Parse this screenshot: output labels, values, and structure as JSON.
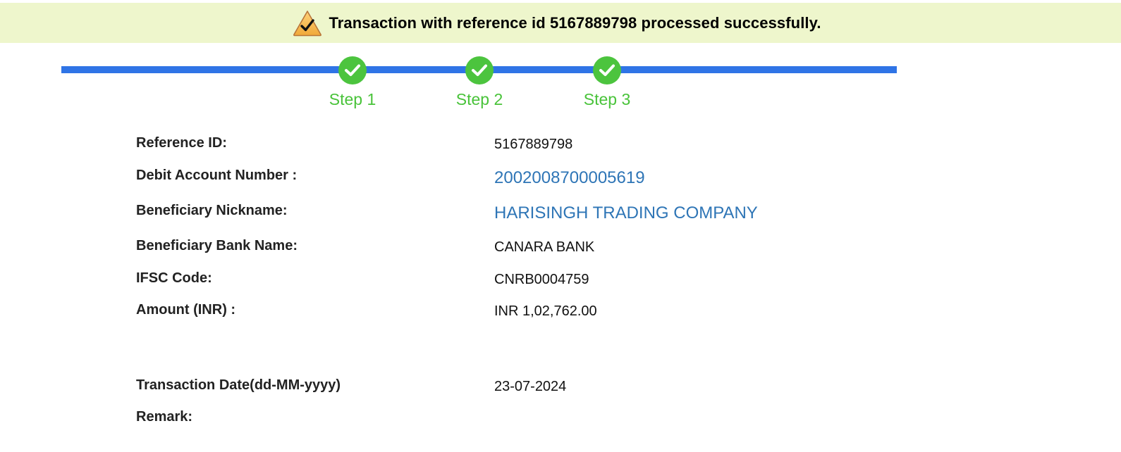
{
  "banner": {
    "message": "Transaction with reference id 5167889798 processed successfully.",
    "icon": "warning-check-icon"
  },
  "progress": {
    "steps": [
      {
        "label": "Step 1",
        "status": "complete"
      },
      {
        "label": "Step 2",
        "status": "complete"
      },
      {
        "label": "Step 3",
        "status": "complete"
      }
    ],
    "colors": {
      "line": "#2f74e6",
      "complete": "#4cc43e"
    }
  },
  "details": {
    "reference_id": {
      "label": "Reference ID:",
      "value": "5167889798"
    },
    "debit_account": {
      "label": "Debit Account Number :",
      "value": "2002008700005619"
    },
    "beneficiary_nickname": {
      "label": "Beneficiary Nickname:",
      "value": "HARISINGH TRADING COMPANY"
    },
    "beneficiary_bank": {
      "label": "Beneficiary Bank Name:",
      "value": "CANARA BANK"
    },
    "ifsc": {
      "label": "IFSC Code:",
      "value": "CNRB0004759"
    },
    "amount": {
      "label": "Amount (INR) :",
      "value": "INR 1,02,762.00"
    },
    "transaction_date": {
      "label": "Transaction Date(dd-MM-yyyy)",
      "value": "23-07-2024"
    },
    "remark": {
      "label": "Remark:",
      "value": ""
    }
  }
}
